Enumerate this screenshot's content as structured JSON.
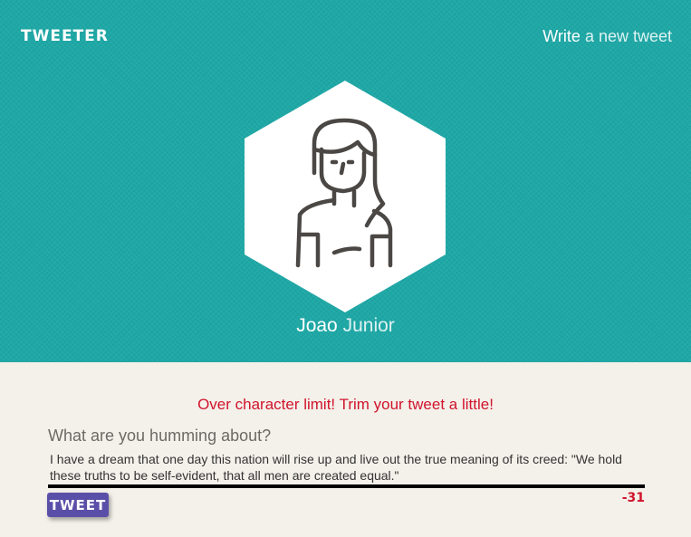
{
  "header": {
    "logo": "TWEETER",
    "write_strong": "Write",
    "write_rest": " a new tweet"
  },
  "profile": {
    "first_name": "Joao",
    "last_name": " Junior",
    "avatar_icon": "female-user-avatar-icon"
  },
  "compose": {
    "error_message": "Over character limit! Trim your tweet a little!",
    "label": "What are you humming about?",
    "value": "I have a dream that one day this nation will rise up and live out the true meaning of its creed: \"We hold these truths to be self-evident, that all men are created equal.\"",
    "counter": "-31",
    "submit_label": "TWEET"
  },
  "colors": {
    "hero_bg": "#1ea8a6",
    "page_bg": "#f4f0ea",
    "error": "#d0142c",
    "button": "#5a4fa8"
  }
}
